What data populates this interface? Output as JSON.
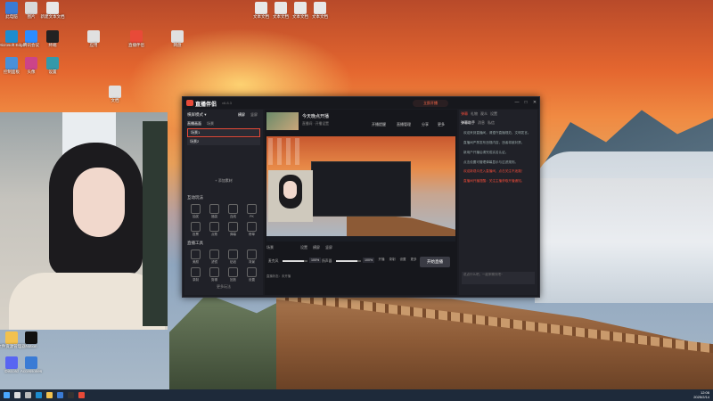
{
  "desktop_icons_top": [
    {
      "label": "此电脑",
      "color": "#3a7bd5"
    },
    {
      "label": "图片",
      "color": "#d9d9d9"
    },
    {
      "label": "新建文本文档",
      "color": "#e8e8e8"
    },
    {
      "label": "文本文档",
      "color": "#e8e8e8"
    },
    {
      "label": "文本文档",
      "color": "#e8e8e8"
    },
    {
      "label": "文本文档",
      "color": "#e8e8e8"
    },
    {
      "label": "文本文档",
      "color": "#e8e8e8"
    }
  ],
  "desktop_icons_left": [
    {
      "label": "Microsoft Edge",
      "color": "#1d8ccf"
    },
    {
      "label": "腾讯会议",
      "color": "#2b8cff"
    },
    {
      "label": "终端",
      "color": "#222"
    },
    {
      "label": "应用",
      "color": "#e0e0e0"
    },
    {
      "label": "直播伴侣",
      "color": "#e84a38"
    },
    {
      "label": "网盘",
      "color": "#e0e0e0"
    },
    {
      "label": "控制面板",
      "color": "#4a90d9"
    },
    {
      "label": "头像",
      "color": "#c48"
    },
    {
      "label": "设置",
      "color": "#39a"
    },
    {
      "label": "文档",
      "color": "#e0e0e0"
    }
  ],
  "desktop_icons_bottom": [
    {
      "label": "文件资源管理器",
      "color": "#f2c14e"
    },
    {
      "label": "Notion",
      "color": "#111"
    },
    {
      "label": "Discord",
      "color": "#5865f2"
    },
    {
      "label": "Accessories",
      "color": "#3a7bd5"
    }
  ],
  "app": {
    "title": "直播伴侣",
    "version": "v6.8.3",
    "promo": "立即开播",
    "window_controls": [
      "—",
      "□",
      "✕"
    ],
    "left_panel": {
      "mode": "横屏模式 ▾",
      "mode_tabs": [
        "横屏",
        "竖屏"
      ],
      "scene_label": "场景",
      "tabs": [
        "直播画面",
        "场景"
      ],
      "scenes": [
        "场景1",
        "场景2"
      ],
      "add_source": "+ 添加素材",
      "interact_title": "互动玩法",
      "interact_tools": [
        "抽奖",
        "福袋",
        "连线",
        "PK",
        "投票",
        "点歌",
        "弹幕",
        "榜单"
      ],
      "tools_title": "直播工具",
      "live_tools": [
        "美颜",
        "滤镜",
        "贴纸",
        "背景",
        "录制",
        "剪辑",
        "回放",
        "设置"
      ],
      "more": "更多玩法"
    },
    "room": {
      "title": "今天晚点开播",
      "subtitle": "直播间 · 开播设置",
      "actions": [
        "开播提醒",
        "直播管理",
        "分享",
        "更多"
      ]
    },
    "scene_bar": {
      "label": "场景",
      "items": [
        "设置",
        "横屏",
        "竖屏"
      ]
    },
    "controls": {
      "mic_label": "麦克风",
      "mic_value": "100%",
      "mic_level": 0.85,
      "speaker_label": "扬声器",
      "speaker_value": "100%",
      "speaker_level": 0.85,
      "buttons": [
        "开播",
        "录制",
        "设置",
        "更多"
      ],
      "go_live": "开始直播",
      "status": "直播状态：未开播"
    },
    "right_panel": {
      "tabs": [
        "弹幕",
        "礼物",
        "观众",
        "设置"
      ],
      "active_tab": "弹幕",
      "sub_tabs": [
        "弹幕助手",
        "消息",
        "私信"
      ],
      "notices": [
        "欢迎来到直播间，请遵守直播规范，文明发言。",
        "直播间严禁发布违规内容，违者将被封禁。",
        "新用户开播后请完成实名认证。",
        "点击设置可管理弹幕显示与过滤规则。"
      ],
      "highlight_1": "欢迎新观众进入直播间，点击关注不迷路！",
      "highlight_2": "直播间开播提醒：关注主播获取开播通知。",
      "chat_placeholder": "说点什么吧，一起来聊天吧~"
    }
  },
  "taskbar": {
    "icons": [
      "start",
      "search",
      "task-view",
      "edge",
      "files",
      "store",
      "terminal",
      "app"
    ],
    "time": "12:06",
    "date": "2025/2/14"
  }
}
